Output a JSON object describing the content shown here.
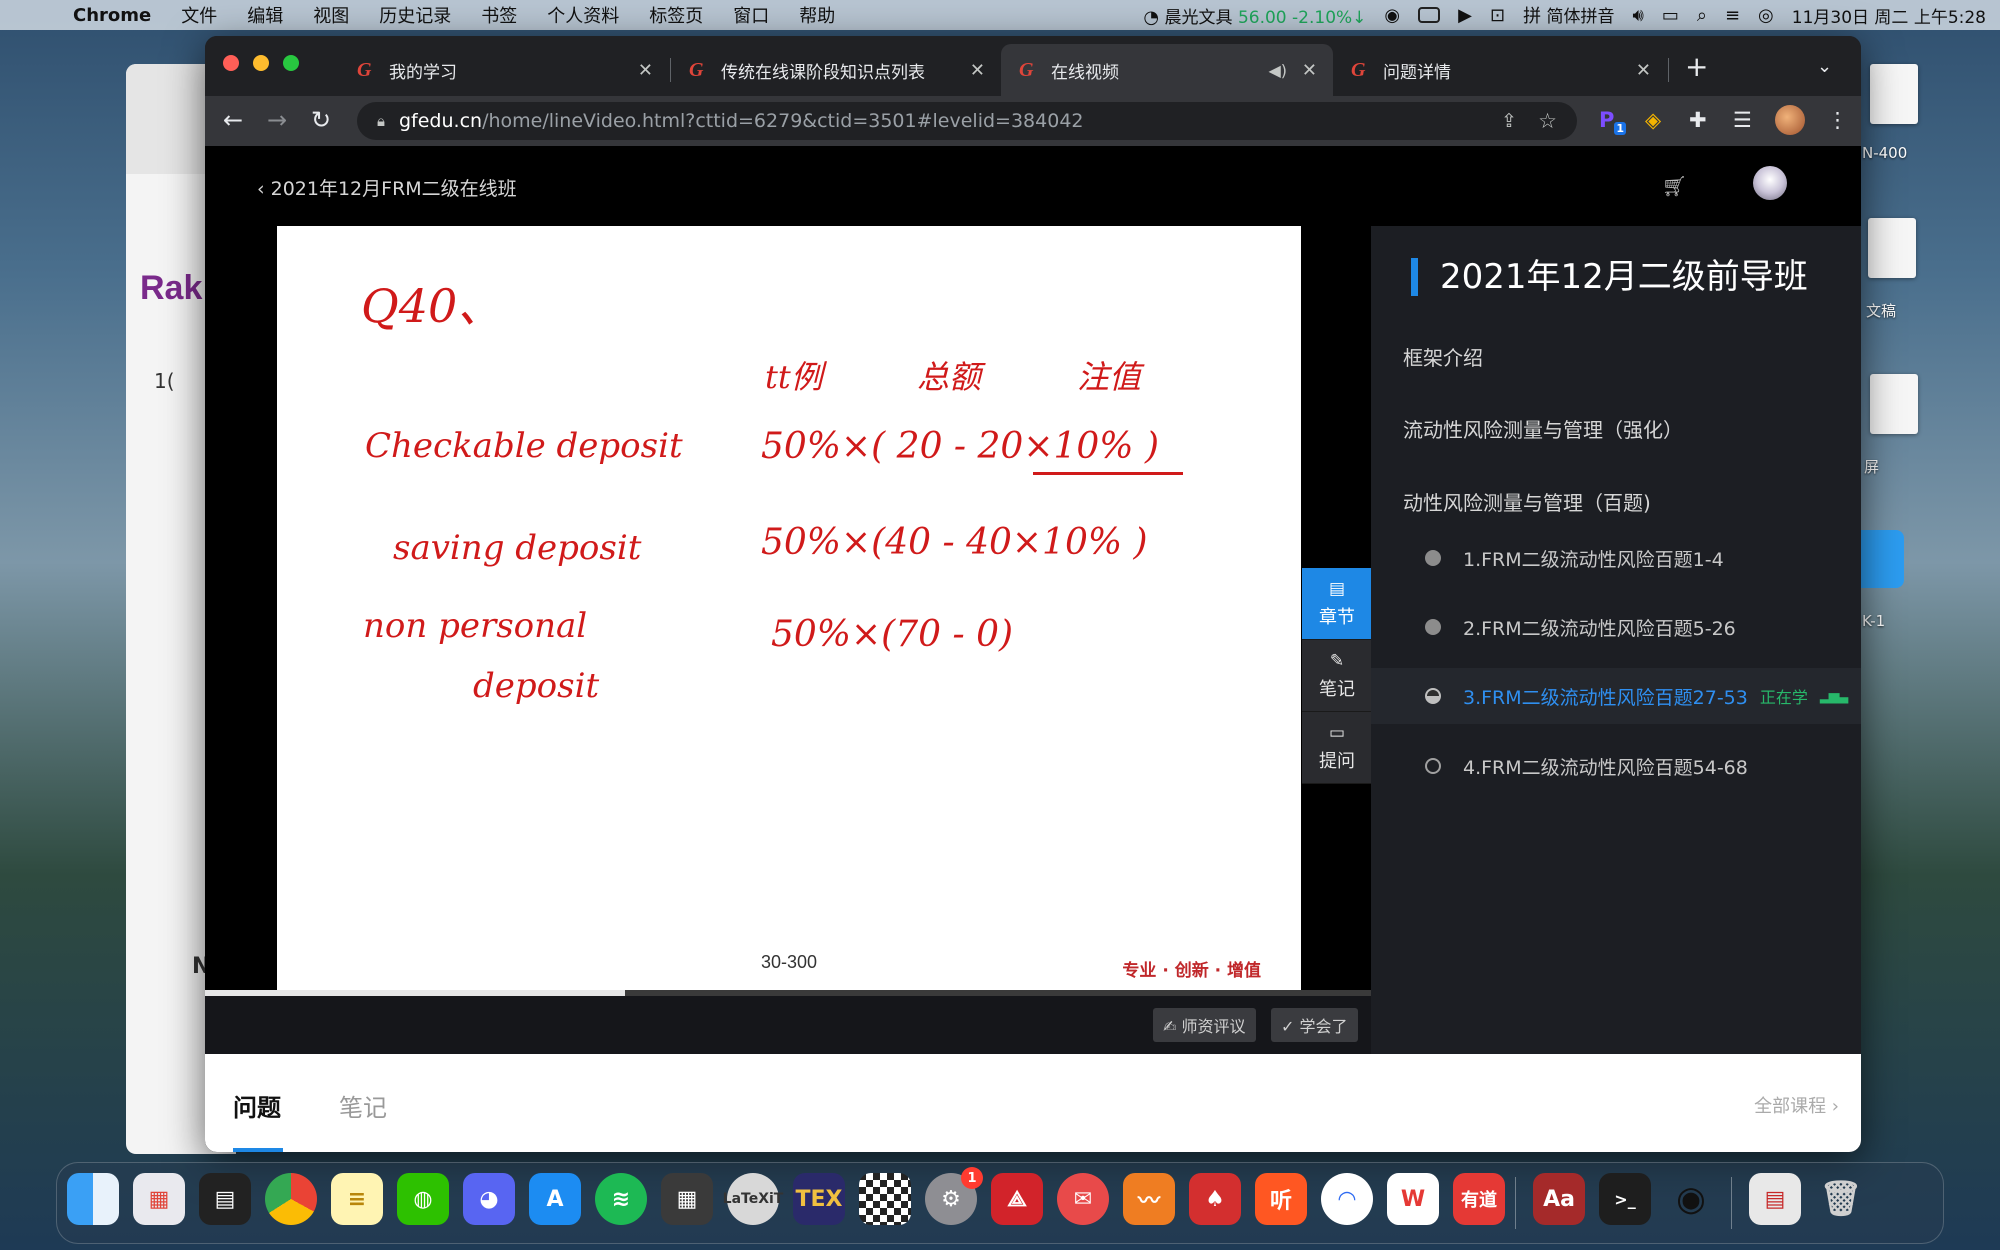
{
  "menubar": {
    "app": "Chrome",
    "menus": [
      "文件",
      "编辑",
      "视图",
      "历史记录",
      "书签",
      "个人资料",
      "标签页",
      "窗口",
      "帮助"
    ],
    "stock_name": "晨光文具",
    "stock_value": "56.00",
    "stock_change": "-2.10%↓",
    "input_method": "简体拼音",
    "datetime": "11月30日 周二 上午5:28"
  },
  "desktop": {
    "bg_window_brand": "Rak",
    "bg_window_coin_text": "1(",
    "bg_window_n": "N",
    "label_1": "N-400",
    "label_2": "文稿",
    "label_3": "屏",
    "label_4": "K-1"
  },
  "browser": {
    "tabs": [
      {
        "title": "我的学习"
      },
      {
        "title": "传统在线课阶段知识点列表"
      },
      {
        "title": "在线视频"
      },
      {
        "title": "问题详情"
      }
    ],
    "url_host": "gfedu.cn",
    "url_path": "/home/lineVideo.html?cttid=6279&ctid=3501#levelid=384042",
    "extension_badge": "1"
  },
  "page": {
    "back_label": "2021年12月FRM二级在线班",
    "slide": {
      "line_q": "Q40、",
      "header_1": "tt例",
      "header_2": "总额",
      "header_3": "注值",
      "row1_label": "Checkable deposit",
      "row1_formula": "50%×( 20 - 20×10% )",
      "row2_label": "saving deposit",
      "row2_formula": "50%×(40 - 40×10% )",
      "row3_label_a": "non personal",
      "row3_label_b": "deposit",
      "row3_formula": "50%×(70 - 0)",
      "page_number": "30-300",
      "slogan": "专业 · 创新 · 增值"
    },
    "video_progress": 0.36,
    "controls": {
      "review_label": "✍ 师资评议",
      "learned_label": "✓ 学会了"
    },
    "side_tools": [
      {
        "icon": "▤",
        "label": "章节"
      },
      {
        "icon": "✎",
        "label": "笔记"
      },
      {
        "icon": "▭",
        "label": "提问"
      }
    ],
    "chapter_panel": {
      "title": "2021年12月二级前导班",
      "sections": [
        "框架介绍",
        "流动性风险测量与管理（强化）",
        "动性风险测量与管理（百题)"
      ],
      "lessons": [
        {
          "label": "1.FRM二级流动性风险百题1-4",
          "state": "done"
        },
        {
          "label": "2.FRM二级流动性风险百题5-26",
          "state": "done"
        },
        {
          "label": "3.FRM二级流动性风险百题27-53",
          "state": "current",
          "status": "正在学"
        },
        {
          "label": "4.FRM二级流动性风险百题54-68",
          "state": "empty"
        }
      ]
    },
    "bottom_tabs": {
      "questions": "问题",
      "notes": "笔记",
      "all_courses": "全部课程 ›"
    }
  },
  "dock": {
    "system_prefs_badge": "1",
    "apps": [
      "finder-icon",
      "launchpad-icon",
      "mission-control-icon",
      "chrome-icon",
      "notes-icon",
      "wechat-icon",
      "discord-icon",
      "app-store-icon",
      "spotify-icon",
      "calculator-icon",
      "latexit-icon",
      "tex-icon",
      "chess-icon",
      "system-preferences-icon",
      "acrobat-icon",
      "mail-icon",
      "stocks-icon",
      "poker-icon",
      "ting-icon",
      "baidu-netdisk-icon",
      "wps-icon",
      "youdao-icon",
      "dictionary-icon",
      "terminal-icon",
      "qq-icon",
      "preview-icon",
      "trash-icon"
    ]
  }
}
